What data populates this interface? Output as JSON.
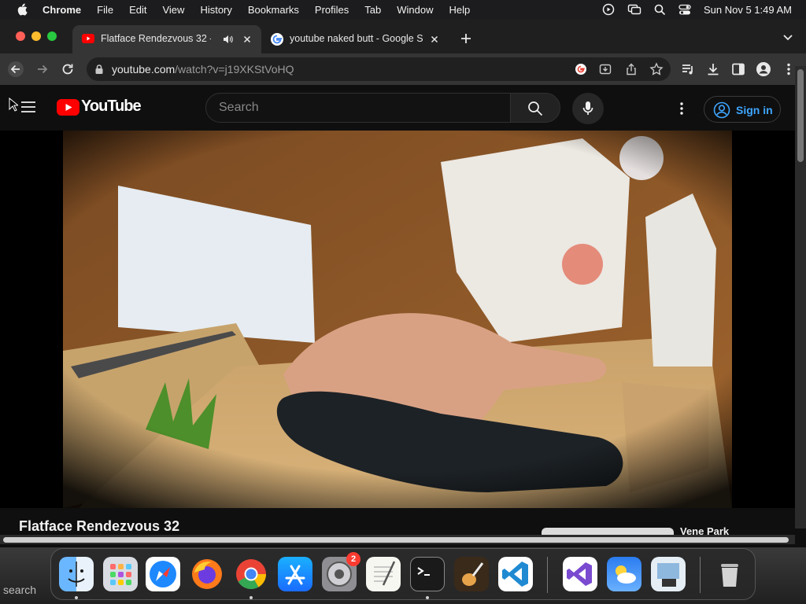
{
  "menubar": {
    "app": "Chrome",
    "items": [
      "File",
      "Edit",
      "View",
      "History",
      "Bookmarks",
      "Profiles",
      "Tab",
      "Window",
      "Help"
    ],
    "clock": "Sun Nov 5  1:49 AM"
  },
  "tabs": [
    {
      "title": "Flatface Rendezvous 32 -",
      "active": true,
      "favicon": "youtube-icon",
      "playing_audio": true
    },
    {
      "title": "youtube naked butt - Google S",
      "active": false,
      "favicon": "google-icon"
    }
  ],
  "address_bar": {
    "host": "youtube.com",
    "path": "/watch?v=j19XKStVoHQ"
  },
  "youtube": {
    "logo": "YouTube",
    "search_placeholder": "Search",
    "sign_in": "Sign in",
    "video_title": "Flatface Rendezvous 32",
    "side_video_title": "Vene Park"
  },
  "dock": {
    "apps": [
      "Finder",
      "Launchpad",
      "Safari",
      "Firefox",
      "Chrome",
      "App Store",
      "System Settings",
      "TextEdit",
      "Terminal",
      "GarageBand",
      "Visual Studio Code",
      "Visual Studio",
      "Weather",
      "Preview",
      "Trash"
    ],
    "settings_badge": "2",
    "desktop_search": "search"
  },
  "colors": {
    "youtube_red": "#ff0000",
    "link_blue": "#3ea6ff",
    "close": "#ff5f57",
    "minimize": "#febc2e",
    "zoom": "#28c840"
  }
}
